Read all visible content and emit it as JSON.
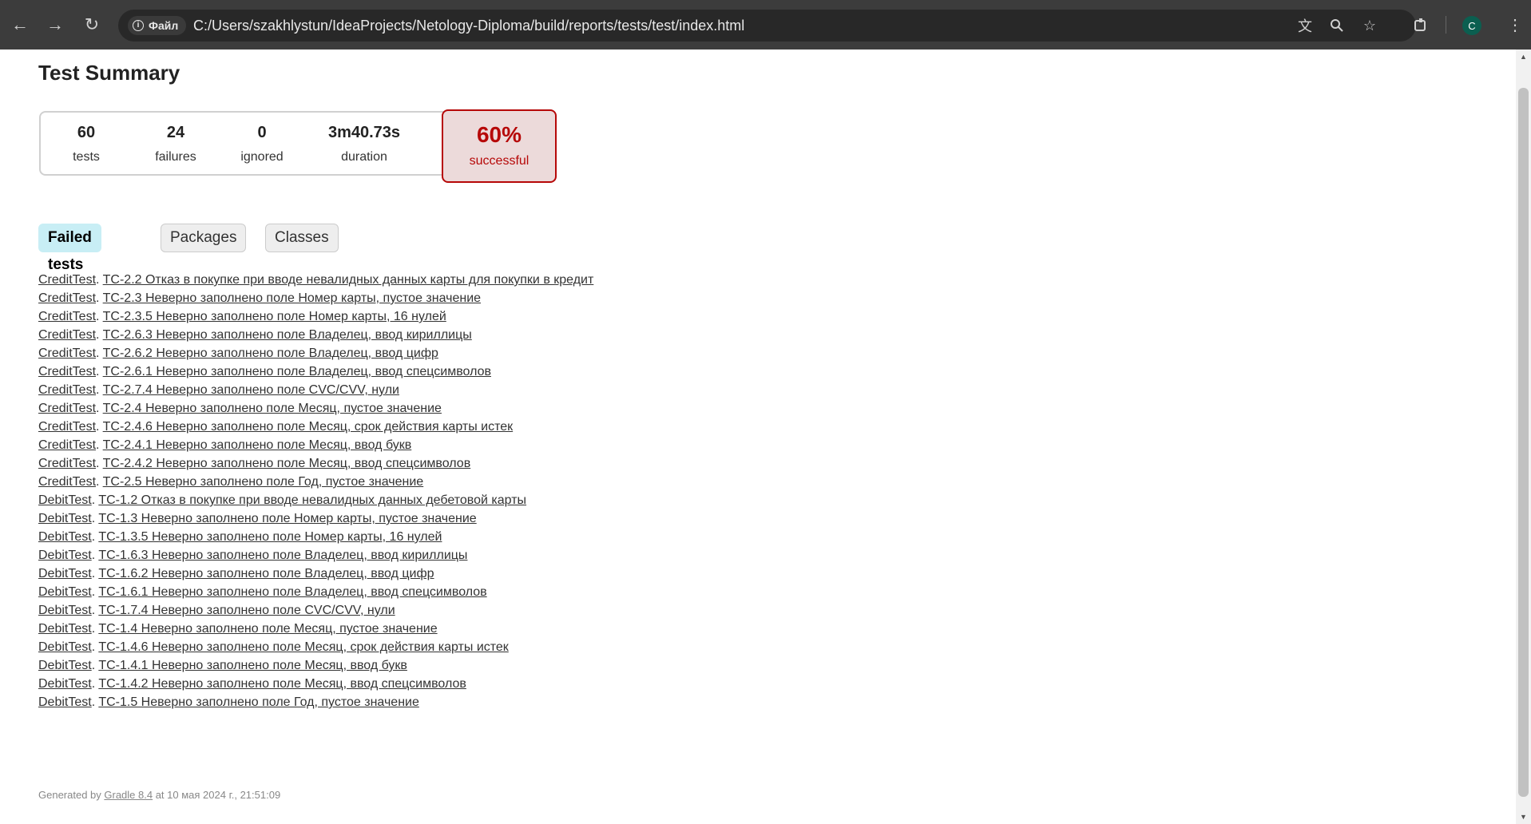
{
  "browser": {
    "chip_label": "Файл",
    "url": "C:/Users/szakhlystun/IdeaProjects/Netology-Diploma/build/reports/tests/test/index.html",
    "avatar_letter": "C"
  },
  "page": {
    "title": "Test Summary",
    "counters": [
      {
        "value": "60",
        "label": "tests"
      },
      {
        "value": "24",
        "label": "failures"
      },
      {
        "value": "0",
        "label": "ignored"
      },
      {
        "value": "3m40.73s",
        "label": "duration"
      }
    ],
    "success": {
      "percent": "60%",
      "label": "successful",
      "color": "#b60808"
    },
    "tabs": [
      "Failed tests",
      "Packages",
      "Classes"
    ],
    "failed_tests": [
      {
        "class": "CreditTest",
        "test": "TC-2.2 Отказ в покупке при вводе невалидных данных карты для покупки в кредит"
      },
      {
        "class": "CreditTest",
        "test": "TC-2.3 Неверно заполнено поле Номер карты, пустое значение"
      },
      {
        "class": "CreditTest",
        "test": "TC-2.3.5 Неверно заполнено поле Номер карты, 16 нулей"
      },
      {
        "class": "CreditTest",
        "test": "TC-2.6.3 Неверно заполнено поле Владелец, ввод кириллицы"
      },
      {
        "class": "CreditTest",
        "test": "TC-2.6.2 Неверно заполнено поле Владелец, ввод цифр"
      },
      {
        "class": "CreditTest",
        "test": "TC-2.6.1 Неверно заполнено поле Владелец, ввод спецсимволов"
      },
      {
        "class": "CreditTest",
        "test": "TC-2.7.4 Неверно заполнено поле CVC/CVV, нули"
      },
      {
        "class": "CreditTest",
        "test": "TC-2.4 Неверно заполнено поле Месяц, пустое значение"
      },
      {
        "class": "CreditTest",
        "test": "TC-2.4.6 Неверно заполнено поле Месяц, срок действия карты истек"
      },
      {
        "class": "CreditTest",
        "test": "TC-2.4.1 Неверно заполнено поле Месяц, ввод букв"
      },
      {
        "class": "CreditTest",
        "test": "TC-2.4.2 Неверно заполнено поле Месяц, ввод спецсимволов"
      },
      {
        "class": "CreditTest",
        "test": "TC-2.5 Неверно заполнено поле Год, пустое значение"
      },
      {
        "class": "DebitTest",
        "test": "TC-1.2 Отказ в покупке при вводе невалидных данных дебетовой карты"
      },
      {
        "class": "DebitTest",
        "test": "TC-1.3 Неверно заполнено поле Номер карты, пустое значение"
      },
      {
        "class": "DebitTest",
        "test": "TC-1.3.5 Неверно заполнено поле Номер карты, 16 нулей"
      },
      {
        "class": "DebitTest",
        "test": "TC-1.6.3 Неверно заполнено поле Владелец, ввод кириллицы"
      },
      {
        "class": "DebitTest",
        "test": "TC-1.6.2 Неверно заполнено поле Владелец, ввод цифр"
      },
      {
        "class": "DebitTest",
        "test": "TC-1.6.1 Неверно заполнено поле Владелец, ввод спецсимволов"
      },
      {
        "class": "DebitTest",
        "test": "TC-1.7.4 Неверно заполнено поле CVC/CVV, нули"
      },
      {
        "class": "DebitTest",
        "test": "TC-1.4 Неверно заполнено поле Месяц, пустое значение"
      },
      {
        "class": "DebitTest",
        "test": "TC-1.4.6 Неверно заполнено поле Месяц, срок действия карты истек"
      },
      {
        "class": "DebitTest",
        "test": "TC-1.4.1 Неверно заполнено поле Месяц, ввод букв"
      },
      {
        "class": "DebitTest",
        "test": "TC-1.4.2 Неверно заполнено поле Месяц, ввод спецсимволов"
      },
      {
        "class": "DebitTest",
        "test": "TC-1.5 Неверно заполнено поле Год, пустое значение"
      }
    ],
    "footer": {
      "prefix": "Generated by ",
      "link": "Gradle 8.4",
      "suffix": " at 10 мая 2024 г., 21:51:09"
    }
  }
}
